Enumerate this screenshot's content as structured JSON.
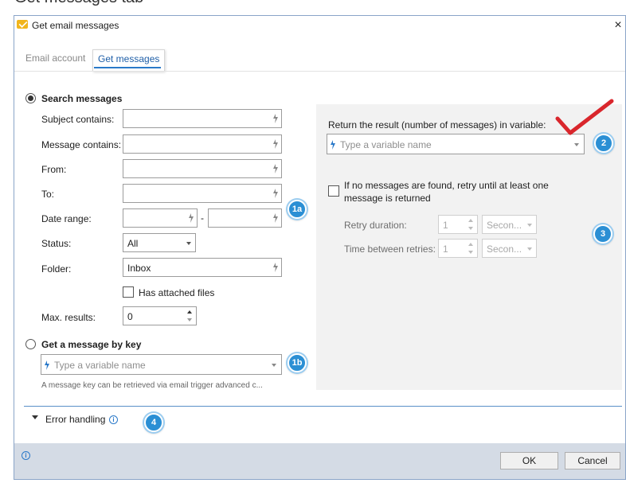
{
  "caption": "Get messages tab",
  "window": {
    "title": "Get email messages",
    "close_glyph": "×",
    "icon": "email-app-icon"
  },
  "tabs": [
    {
      "label": "Email account",
      "active": false
    },
    {
      "label": "Get messages",
      "active": true
    }
  ],
  "search": {
    "radio_label": "Search messages",
    "subject_label": "Subject contains:",
    "message_label": "Message contains:",
    "from_label": "From:",
    "to_label": "To:",
    "date_label": "Date range:",
    "date_separator": "-",
    "status_label": "Status:",
    "status_value": "All",
    "folder_label": "Folder:",
    "folder_value": "Inbox",
    "attached_label": "Has attached files",
    "max_label": "Max. results:",
    "max_value": "0"
  },
  "bykey": {
    "radio_label": "Get a message by key",
    "placeholder": "Type a variable name",
    "hint": "A message key can be retrieved via email trigger advanced c..."
  },
  "result": {
    "label": "Return the result (number of messages) in variable:",
    "placeholder": "Type a variable name",
    "retry_line1": "If no messages are found, retry until at least one",
    "retry_line2": "message is returned",
    "duration_label": "Retry duration:",
    "duration_value": "1",
    "duration_unit": "Secon...",
    "between_label": "Time between retries:",
    "between_value": "1",
    "between_unit": "Secon..."
  },
  "error_handling": {
    "label": "Error handling"
  },
  "footer": {
    "ok_label": "OK",
    "cancel_label": "Cancel",
    "info_glyph": "i"
  },
  "badges": {
    "b1a": "1a",
    "b1b": "1b",
    "b2": "2",
    "b3": "3",
    "b4": "4"
  },
  "colors": {
    "accent": "#2a79c9",
    "badge": "#2b8fd4",
    "checkmark": "#d9262c",
    "footer": "#d4dbe5"
  }
}
